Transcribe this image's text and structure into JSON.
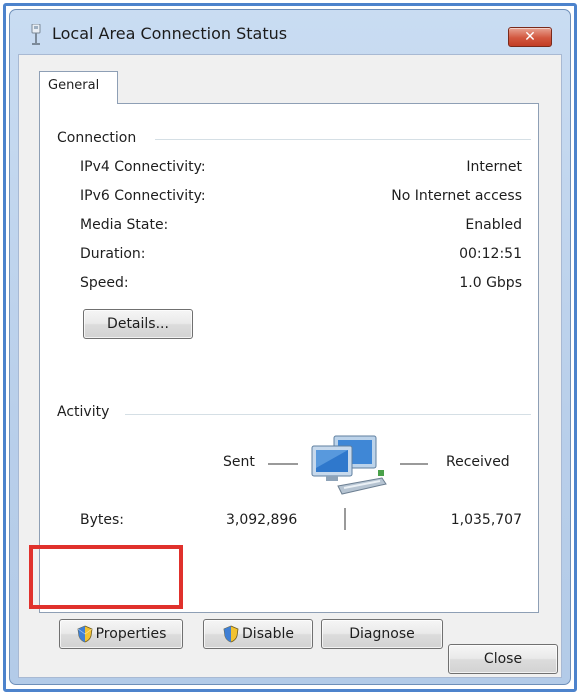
{
  "window": {
    "title": "Local Area Connection Status",
    "close_glyph": "✕"
  },
  "tabs": [
    {
      "label": "General"
    }
  ],
  "connection": {
    "title": "Connection",
    "rows": [
      {
        "label": "IPv4 Connectivity:",
        "value": "Internet"
      },
      {
        "label": "IPv6 Connectivity:",
        "value": "No Internet access"
      },
      {
        "label": "Media State:",
        "value": "Enabled"
      },
      {
        "label": "Duration:",
        "value": "00:12:51"
      },
      {
        "label": "Speed:",
        "value": "1.0 Gbps"
      }
    ],
    "details_label": "Details..."
  },
  "activity": {
    "title": "Activity",
    "sent_label": "Sent",
    "received_label": "Received",
    "bytes_label": "Bytes:",
    "bytes_sent": "3,092,896",
    "bytes_received": "1,035,707"
  },
  "buttons": {
    "properties_label": "Properties",
    "disable_label": "Disable",
    "diagnose_label": "Diagnose",
    "close_label": "Close"
  },
  "icons": {
    "title": "network-adapter-icon",
    "activity": "network-computers-icon",
    "uac": "uac-shield-icon"
  },
  "colors": {
    "highlight": "#e0312c",
    "frame": "#4d83cc",
    "close_button": "#c23d25"
  }
}
